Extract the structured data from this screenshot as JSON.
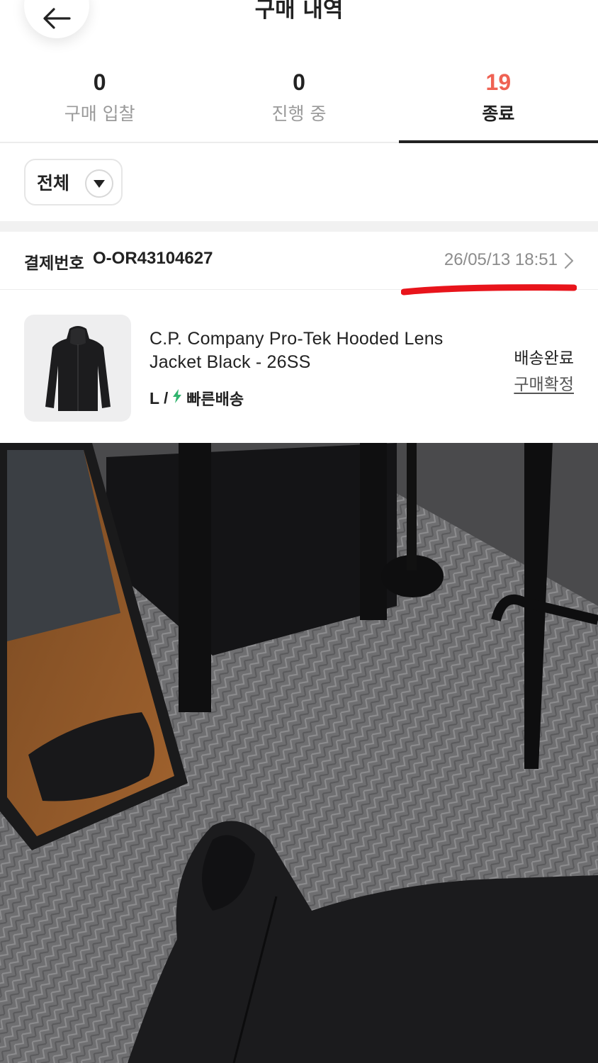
{
  "header": {
    "title": "구매 내역",
    "back_icon": "arrow-left-icon"
  },
  "tabs": [
    {
      "count": "0",
      "label": "구매 입찰"
    },
    {
      "count": "0",
      "label": "진행 중"
    },
    {
      "count": "19",
      "label": "종료"
    }
  ],
  "filter": {
    "selected": "전체",
    "icon": "caret-down-icon"
  },
  "order": {
    "number_label": "결제번호",
    "number": "O-OR43104627",
    "datetime": "26/05/13 18:51"
  },
  "product": {
    "name": "C.P. Company Pro-Tek Hooded Lens Jacket Black - 26SS",
    "size": "L",
    "separator": "/",
    "shipping": "빠른배송",
    "status": "배송완료",
    "confirm_label": "구매확정"
  },
  "colors": {
    "accent": "#ef6253",
    "fast_shipping": "#31b46e",
    "annotation": "#e8141b"
  }
}
